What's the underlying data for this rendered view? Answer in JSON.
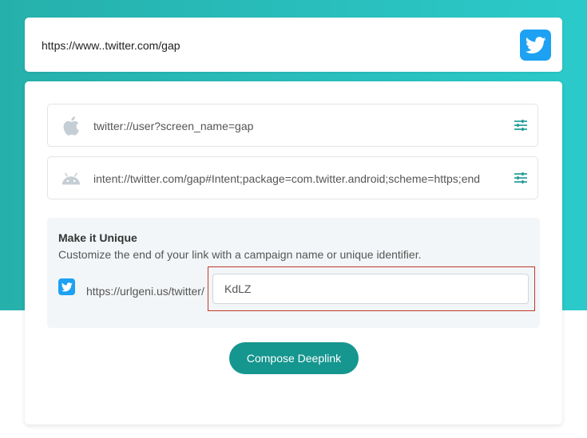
{
  "header": {
    "url": "https://www..twitter.com/gap",
    "brand_icon": "twitter-logo-icon",
    "brand_color": "#1da1f2"
  },
  "links": {
    "ios": {
      "icon": "apple-icon",
      "value": "twitter://user?screen_name=gap"
    },
    "android": {
      "icon": "android-icon",
      "value": "intent://twitter.com/gap#Intent;package=com.twitter.android;scheme=https;end"
    }
  },
  "unique": {
    "title": "Make it Unique",
    "description": "Customize the end of your link with a campaign name or unique identifier.",
    "prefix": "https://urlgeni.us/twitter/",
    "identifier_value": "KdLZ"
  },
  "actions": {
    "compose_label": "Compose Deeplink",
    "accent_color": "#15968f"
  }
}
